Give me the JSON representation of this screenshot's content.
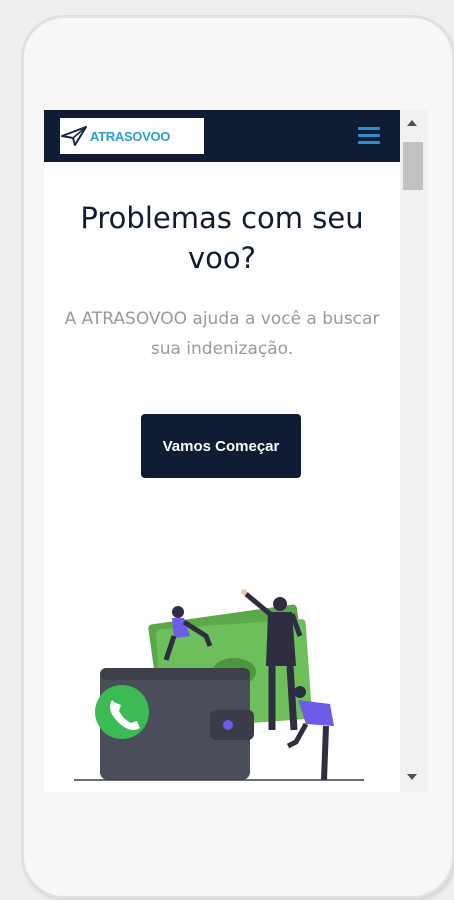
{
  "header": {
    "brand": "ATRASOVOO",
    "logo_icon": "paper-plane-icon",
    "menu_icon": "hamburger-menu-icon"
  },
  "hero": {
    "title": "Problemas com seu voo?",
    "subtitle": "A ATRASOVOO ajuda a você a buscar sua indenização.",
    "cta_label": "Vamos Começar"
  },
  "illustration": {
    "description_icon": "wallet-money-people-illustration",
    "whatsapp_icon": "whatsapp-icon"
  },
  "colors": {
    "navbar": "#0f1c33",
    "brand_blue": "#2a9fd6",
    "cta_bg": "#0f1c33",
    "money_green": "#5aa84a",
    "whatsapp_green": "#3cba54",
    "wallet": "#4a4d5a",
    "accent_purple": "#6c5ce7"
  }
}
